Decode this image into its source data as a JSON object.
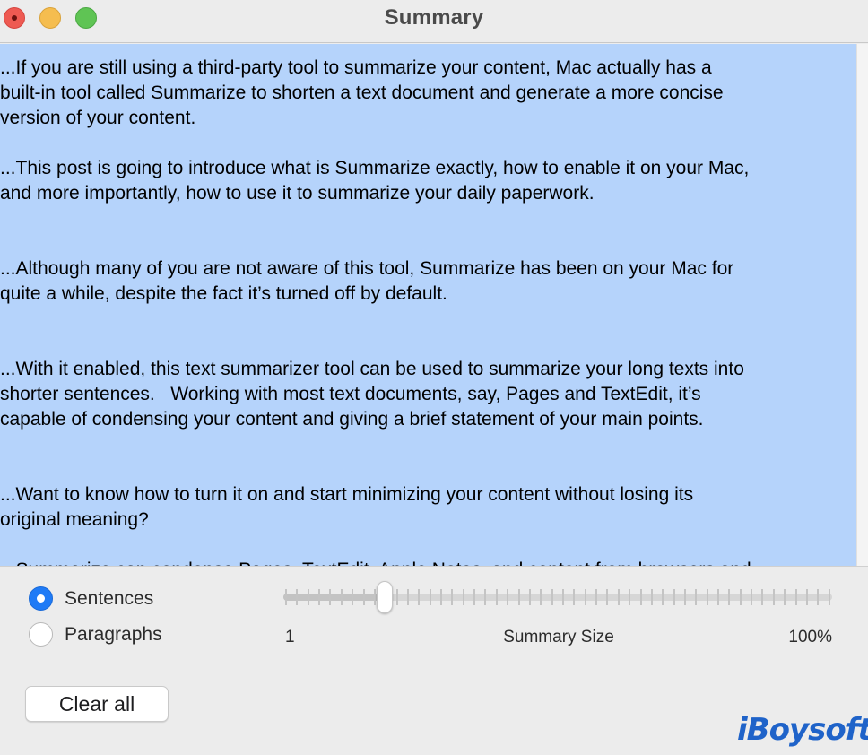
{
  "window": {
    "title": "Summary"
  },
  "summary_text": {
    "paragraphs": [
      "...If you are still using a third-party tool to summarize your content, Mac actually has a\nbuilt-in tool called Summarize to shorten a text document and generate a more concise\nversion of your content.",
      "...This post is going to introduce what is Summarize exactly, how to enable it on your Mac,\nand more importantly, how to use it to summarize your daily paperwork.",
      "...Although many of you are not aware of this tool, Summarize has been on your Mac for\nquite a while, despite the fact it’s turned off by default.",
      "...With it enabled, this text summarizer tool can be used to summarize your long texts into\nshorter sentences.   Working with most text documents, say, Pages and TextEdit, it’s\ncapable of condensing your content and giving a brief statement of your main points.",
      "...Want to know how to turn it on and start minimizing your content without losing its\noriginal meaning?",
      "...Summarize can condense Pages, TextEdit, Apple Notes, and content from browsers and"
    ],
    "selected": true
  },
  "summarize_by": {
    "options": [
      {
        "label": "Sentences",
        "checked": true
      },
      {
        "label": "Paragraphs",
        "checked": false
      }
    ]
  },
  "summary_size_slider": {
    "caption": "Summary Size",
    "min_label": "1",
    "max_label": "100%",
    "value_fraction": 0.175,
    "tick_count": 50
  },
  "actions": {
    "clear_all_label": "Clear all"
  },
  "watermark": {
    "text": "iBoysoft"
  },
  "colors": {
    "selection": "#b5d3fb",
    "accent": "#1f7bf6",
    "close": "#ee5a52",
    "minimize": "#f5bd4f",
    "zoom": "#5fc454",
    "watermark": "#1f63c9"
  }
}
